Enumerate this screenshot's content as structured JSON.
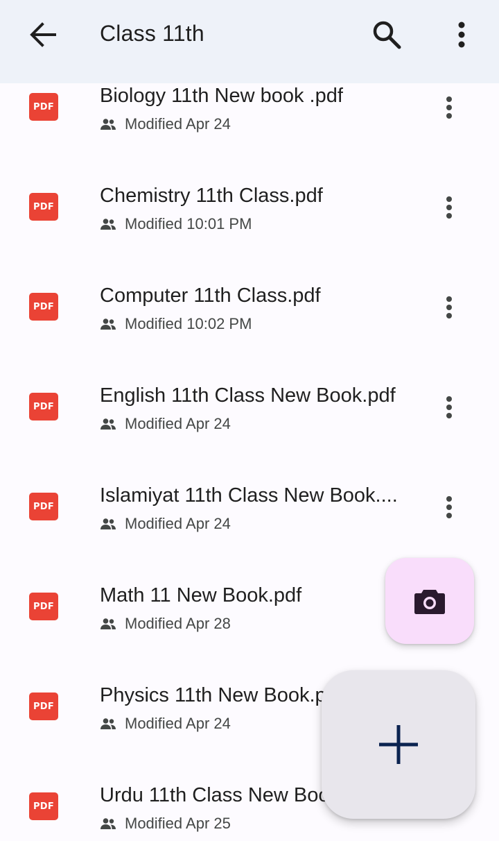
{
  "header": {
    "title": "Class 11th",
    "back_icon": "arrow-back-icon",
    "search_icon": "search-icon",
    "more_icon": "more-vert-icon"
  },
  "files": [
    {
      "name": "Biology 11th New book .pdf",
      "modified": "Modified Apr 24",
      "type_label": "PDF"
    },
    {
      "name": "Chemistry 11th Class.pdf",
      "modified": "Modified 10:01 PM",
      "type_label": "PDF"
    },
    {
      "name": "Computer 11th Class.pdf",
      "modified": "Modified 10:02 PM",
      "type_label": "PDF"
    },
    {
      "name": "English 11th Class New Book.pdf",
      "modified": "Modified Apr 24",
      "type_label": "PDF"
    },
    {
      "name": "Islamiyat 11th Class New Book....",
      "modified": "Modified Apr 24",
      "type_label": "PDF"
    },
    {
      "name": "Math 11 New Book.pdf",
      "modified": "Modified Apr 28",
      "type_label": "PDF"
    },
    {
      "name": "Physics 11th New Book.p",
      "modified": "Modified Apr 24",
      "type_label": "PDF"
    },
    {
      "name": "Urdu 11th Class New Boo",
      "modified": "Modified Apr 25",
      "type_label": "PDF"
    }
  ],
  "fabs": {
    "scan_icon": "camera-icon",
    "create_icon": "plus-icon"
  },
  "colors": {
    "pdf_red": "#ea4335",
    "top_bar_bg": "#eef2f9",
    "camera_fab_bg": "#f9ddfb",
    "create_fab_bg": "#e8e6ec",
    "create_plus": "#0b2350"
  }
}
